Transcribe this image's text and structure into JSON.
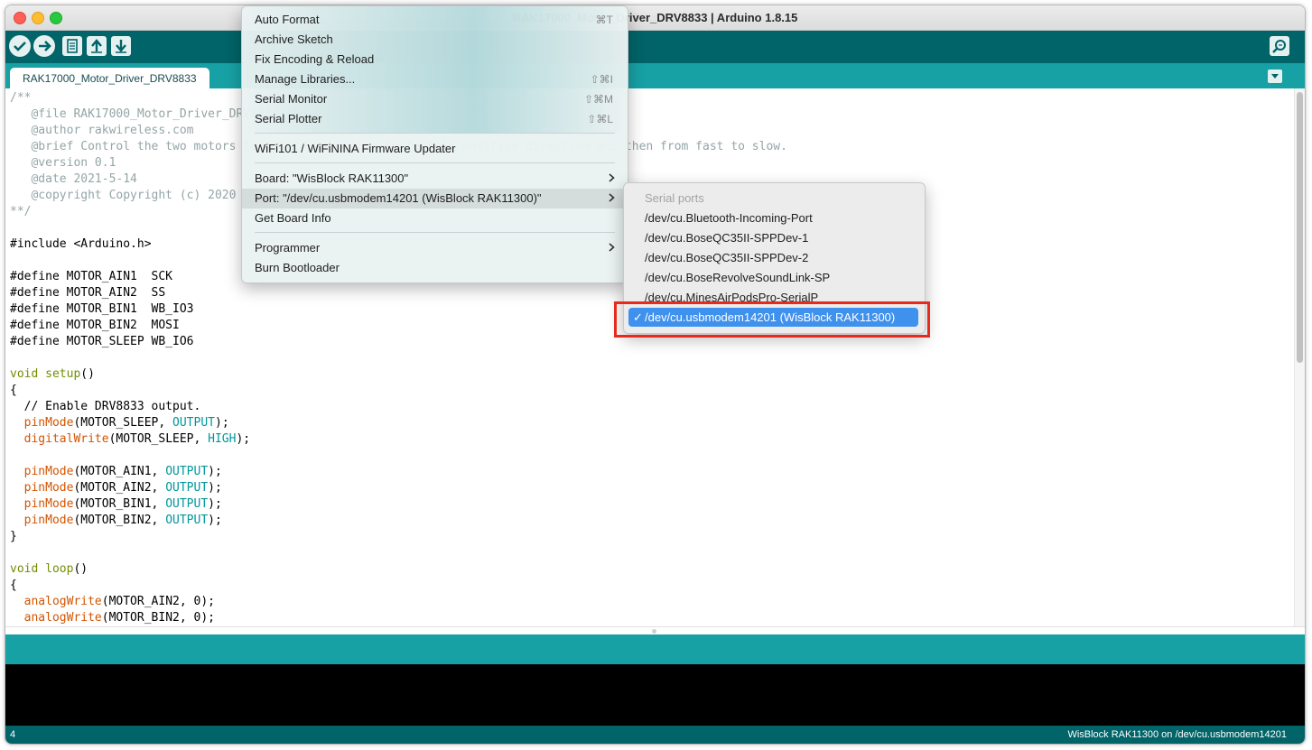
{
  "window": {
    "title": "RAK17000_Motor_Driver_DRV8833 | Arduino 1.8.15"
  },
  "tab": {
    "label": "RAK17000_Motor_Driver_DRV8833"
  },
  "code": [
    [
      {
        "t": "/**",
        "c": "comment"
      }
    ],
    [
      {
        "t": "   @file RAK17000_Motor_Driver_DRV8833.ino",
        "c": "comment"
      }
    ],
    [
      {
        "t": "   @author rakwireless.com",
        "c": "comment"
      }
    ],
    [
      {
        "t": "   @brief Control the two motors to rotate from slow to fast in positive direction and then from fast to slow.",
        "c": "comment"
      }
    ],
    [
      {
        "t": "   @version 0.1",
        "c": "comment"
      }
    ],
    [
      {
        "t": "   @date 2021-5-14",
        "c": "comment"
      }
    ],
    [
      {
        "t": "   @copyright Copyright (c) 2020",
        "c": "comment"
      }
    ],
    [
      {
        "t": "**/",
        "c": "comment"
      }
    ],
    [],
    [
      {
        "t": "#include <Arduino.h>"
      }
    ],
    [],
    [
      {
        "t": "#define MOTOR_AIN1  SCK"
      }
    ],
    [
      {
        "t": "#define MOTOR_AIN2  SS"
      }
    ],
    [
      {
        "t": "#define MOTOR_BIN1  WB_IO3"
      }
    ],
    [
      {
        "t": "#define MOTOR_BIN2  MOSI"
      }
    ],
    [
      {
        "t": "#define MOTOR_SLEEP WB_IO6"
      }
    ],
    [],
    [
      {
        "t": "void",
        "c": "kw"
      },
      {
        "t": " "
      },
      {
        "t": "setup",
        "c": "kw"
      },
      {
        "t": "()"
      }
    ],
    [
      {
        "t": "{"
      }
    ],
    [
      {
        "t": "  // Enable DRV8833 output."
      }
    ],
    [
      {
        "t": "  "
      },
      {
        "t": "pinMode",
        "c": "fn"
      },
      {
        "t": "(MOTOR_SLEEP, "
      },
      {
        "t": "OUTPUT",
        "c": "const"
      },
      {
        "t": ");"
      }
    ],
    [
      {
        "t": "  "
      },
      {
        "t": "digitalWrite",
        "c": "fn"
      },
      {
        "t": "(MOTOR_SLEEP, "
      },
      {
        "t": "HIGH",
        "c": "const"
      },
      {
        "t": ");"
      }
    ],
    [],
    [
      {
        "t": "  "
      },
      {
        "t": "pinMode",
        "c": "fn"
      },
      {
        "t": "(MOTOR_AIN1, "
      },
      {
        "t": "OUTPUT",
        "c": "const"
      },
      {
        "t": ");"
      }
    ],
    [
      {
        "t": "  "
      },
      {
        "t": "pinMode",
        "c": "fn"
      },
      {
        "t": "(MOTOR_AIN2, "
      },
      {
        "t": "OUTPUT",
        "c": "const"
      },
      {
        "t": ");"
      }
    ],
    [
      {
        "t": "  "
      },
      {
        "t": "pinMode",
        "c": "fn"
      },
      {
        "t": "(MOTOR_BIN1, "
      },
      {
        "t": "OUTPUT",
        "c": "const"
      },
      {
        "t": ");"
      }
    ],
    [
      {
        "t": "  "
      },
      {
        "t": "pinMode",
        "c": "fn"
      },
      {
        "t": "(MOTOR_BIN2, "
      },
      {
        "t": "OUTPUT",
        "c": "const"
      },
      {
        "t": ");"
      }
    ],
    [
      {
        "t": "}"
      }
    ],
    [],
    [
      {
        "t": "void",
        "c": "kw"
      },
      {
        "t": " "
      },
      {
        "t": "loop",
        "c": "kw"
      },
      {
        "t": "()"
      }
    ],
    [
      {
        "t": "{"
      }
    ],
    [
      {
        "t": "  "
      },
      {
        "t": "analogWrite",
        "c": "fn"
      },
      {
        "t": "(MOTOR_AIN2, 0);"
      }
    ],
    [
      {
        "t": "  "
      },
      {
        "t": "analogWrite",
        "c": "fn"
      },
      {
        "t": "(MOTOR_BIN2, 0);"
      }
    ]
  ],
  "tools_menu": {
    "items": [
      {
        "name": "auto-format",
        "label": "Auto Format",
        "shortcut": "⌘T"
      },
      {
        "name": "archive-sketch",
        "label": "Archive Sketch"
      },
      {
        "name": "fix-encoding",
        "label": "Fix Encoding & Reload"
      },
      {
        "name": "manage-libraries",
        "label": "Manage Libraries...",
        "shortcut": "⇧⌘I"
      },
      {
        "name": "serial-monitor",
        "label": "Serial Monitor",
        "shortcut": "⇧⌘M"
      },
      {
        "name": "serial-plotter",
        "label": "Serial Plotter",
        "shortcut": "⇧⌘L"
      },
      {
        "name": "firmware-updater",
        "label": "WiFi101 / WiFiNINA Firmware Updater"
      },
      {
        "name": "board",
        "label": "Board: \"WisBlock RAK11300\"",
        "submenu": true
      },
      {
        "name": "port",
        "label": "Port: \"/dev/cu.usbmodem14201 (WisBlock RAK11300)\"",
        "submenu": true,
        "highlighted": true
      },
      {
        "name": "get-board-info",
        "label": "Get Board Info"
      },
      {
        "name": "programmer",
        "label": "Programmer",
        "submenu": true
      },
      {
        "name": "burn-bootloader",
        "label": "Burn Bootloader"
      }
    ]
  },
  "port_submenu": {
    "header": "Serial ports",
    "items": [
      "/dev/cu.Bluetooth-Incoming-Port",
      "/dev/cu.BoseQC35II-SPPDev-1",
      "/dev/cu.BoseQC35II-SPPDev-2",
      "/dev/cu.BoseRevolveSoundLink-SP",
      "/dev/cu.MinesAirPodsPro-SerialP"
    ],
    "selected": "/dev/cu.usbmodem14201 (WisBlock RAK11300)",
    "check": "✓"
  },
  "status": {
    "line": "4",
    "board_port": "WisBlock RAK11300 on /dev/cu.usbmodem14201"
  },
  "colors": {
    "toolbar": "#006468",
    "tabbar": "#17a1a5",
    "selection": "#3f91ee",
    "highlight_border": "#e8291c"
  }
}
